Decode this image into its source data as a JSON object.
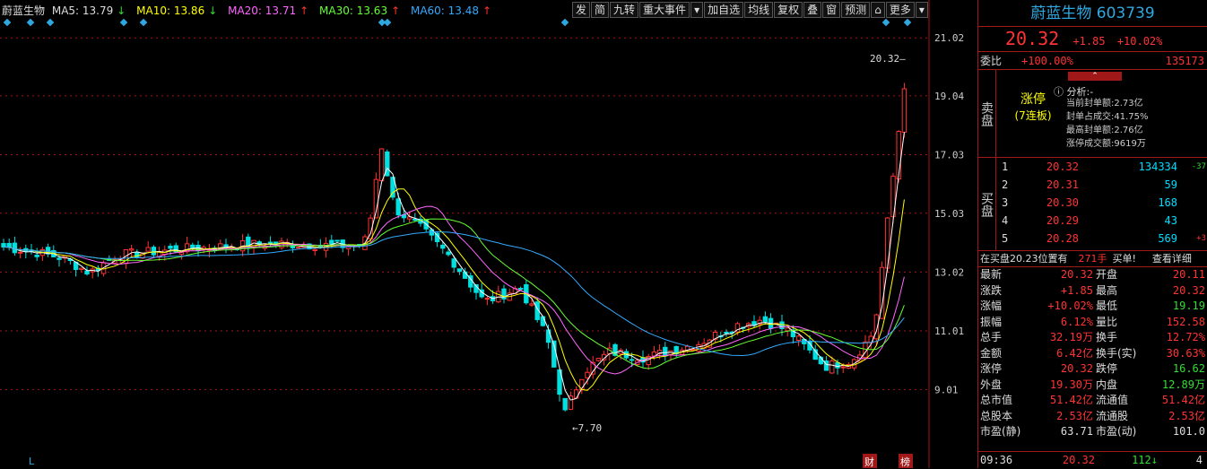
{
  "ma_bar": {
    "name": "蔚蓝生物",
    "ma5": "MA5: 13.79",
    "ma5_arrow": "↓",
    "ma10": "MA10: 13.86",
    "ma10_arrow": "↓",
    "ma20": "MA20: 13.71",
    "ma20_arrow": "↑",
    "ma30": "MA30: 13.63",
    "ma30_arrow": "↑",
    "ma60": "MA60: 13.48",
    "ma60_arrow": "↑"
  },
  "toolbar": [
    "发",
    "简",
    "九转",
    "重大事件",
    "▾",
    "加自选",
    "均线",
    "复权",
    "叠",
    "窗",
    "预测",
    "⌂",
    "更多",
    "▾"
  ],
  "axis_labels": [
    "21.02",
    "19.04",
    "17.03",
    "15.03",
    "13.02",
    "11.01",
    "9.01"
  ],
  "chart_annotations": {
    "high": "20.32",
    "low": "7.70",
    "bottom_left": "L",
    "bottom_cai": "财",
    "bottom_bang": "榜"
  },
  "chart_data": {
    "type": "candlestick",
    "ylim": [
      7.0,
      21.7
    ],
    "high_label": 20.32,
    "low_label": 7.7
  },
  "side": {
    "name": "蔚蓝生物",
    "code": "603739",
    "price": "20.32",
    "change": "+1.85",
    "pct": "+10.02%",
    "weibi_label": "委比",
    "weibi_val": "+100.00%",
    "weibi_num": "135173",
    "sell_label": "卖盘",
    "limit_up": "涨停",
    "limit_up_sub": "(7连板)",
    "analysis_title": "分析:-",
    "analysis": [
      [
        "当前封单额:",
        "2.73亿"
      ],
      [
        "封单占成交:",
        "41.75%"
      ],
      [
        "最高封单额:",
        "2.76亿"
      ],
      [
        "涨停成交额:",
        "9619万"
      ]
    ],
    "buy_label": "买盘",
    "buys": [
      [
        "1",
        "20.32",
        "134334",
        "-37"
      ],
      [
        "2",
        "20.31",
        "59",
        ""
      ],
      [
        "3",
        "20.30",
        "168",
        ""
      ],
      [
        "4",
        "20.29",
        "43",
        ""
      ],
      [
        "5",
        "20.28",
        "569",
        "+3"
      ]
    ],
    "notice": "在买盘20.23位置有",
    "notice_num": "271手",
    "notice_tail": "买单!",
    "notice_link": "查看详细",
    "stats": [
      [
        "最新",
        "20.32",
        "开盘",
        "20.11"
      ],
      [
        "涨跌",
        "+1.85",
        "最高",
        "20.32"
      ],
      [
        "涨幅",
        "+10.02%",
        "最低",
        "19.19"
      ],
      [
        "振幅",
        "6.12%",
        "量比",
        "152.58"
      ],
      [
        "总手",
        "32.19万",
        "换手",
        "12.72%"
      ],
      [
        "金额",
        "6.42亿",
        "换手(实)",
        "30.63%"
      ],
      [
        "涨停",
        "20.32",
        "跌停",
        "16.62"
      ],
      [
        "外盘",
        "19.30万",
        "内盘",
        "12.89万"
      ],
      [
        "总市值",
        "51.42亿",
        "流通值",
        "51.42亿"
      ],
      [
        "总股本",
        "2.53亿",
        "流通股",
        "2.53亿"
      ],
      [
        "市盈(静)",
        "63.71",
        "市盈(动)",
        "101.0"
      ]
    ],
    "foot_time": "09:36",
    "foot_price": "20.32",
    "foot_vol": "112",
    "foot_n": "4"
  },
  "colors": {
    "up": "#ff3333",
    "down": "#00e0e0",
    "ma5": "#ffffff",
    "ma10": "#ffff00",
    "ma20": "#ff66ff",
    "ma30": "#66ff33",
    "ma60": "#33aaff",
    "frame": "#a01818"
  }
}
